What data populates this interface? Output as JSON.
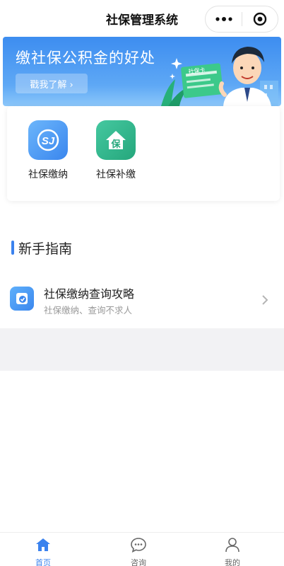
{
  "header": {
    "title": "社保管理系统",
    "more_icon": "more-dots-icon",
    "close_icon": "target-close-icon"
  },
  "banner": {
    "title": "缴社保公积金的好处",
    "button_label": "戳我了解 ›",
    "card_text": "社保卡"
  },
  "services": [
    {
      "label": "社保缴纳",
      "icon": "social-security-icon",
      "color": "#3b8cf0"
    },
    {
      "label": "社保补缴",
      "icon": "house-bao-icon",
      "icon_text": "保",
      "color": "#2fb48a"
    }
  ],
  "guide_section": {
    "title": "新手指南",
    "items": [
      {
        "title": "社保缴纳查询攻略",
        "subtitle": "社保缴纳、查询不求人",
        "icon": "shield-check-icon"
      }
    ]
  },
  "tabbar": {
    "items": [
      {
        "label": "首页",
        "icon": "home-icon",
        "active": true
      },
      {
        "label": "咨询",
        "icon": "chat-icon",
        "active": false
      },
      {
        "label": "我的",
        "icon": "user-icon",
        "active": false
      }
    ],
    "active_color": "#3a82ee",
    "inactive_color": "#666666"
  }
}
